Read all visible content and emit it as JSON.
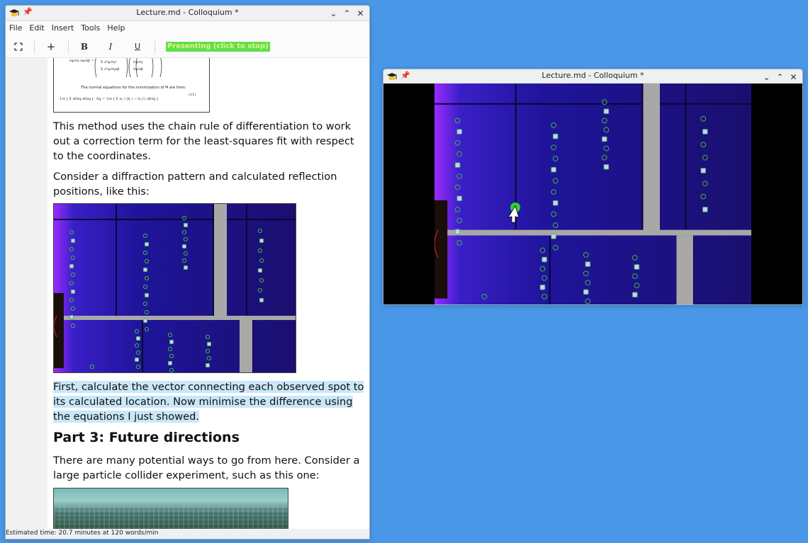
{
  "main_window": {
    "title": "Lecture.md - Colloquium *",
    "menu": [
      "File",
      "Edit",
      "Insert",
      "Tools",
      "Help"
    ],
    "toolbar": {
      "add_label": "+",
      "bold_label": "B",
      "italic_label": "I",
      "underline_label": "U",
      "presenting_label": "Presenting (click to stop)"
    },
    "content": {
      "equation_caption": "The normal equations for the minimization of Ψ are then:",
      "equation_number": "(11)",
      "para1": "This method uses the chain rule of differentiation to work out a correction term for the least-squares fit with respect to the coordinates.",
      "para2": "Consider a diffraction pattern and calculated reflection positions, like this:",
      "para3": "First, calculate the vector connecting each observed spot to its calculated location.  Now minimise the difference using the equations I just showed.",
      "heading": "Part 3: Future directions",
      "para4": "There are many potential ways to go from here.  Consider a large particle collider experiment, such as this one:"
    },
    "status": "Estimated time: 20.7 minutes at 120 words/min"
  },
  "presentation_window": {
    "title": "Lecture.md - Colloquium *"
  },
  "colors": {
    "desktop": "#4a97e8",
    "presenting_bg": "#5ee04a",
    "highlight": "#c9e7f8",
    "detector_bg": "#1a0f6e",
    "pointer_dot": "#2fd22f"
  }
}
